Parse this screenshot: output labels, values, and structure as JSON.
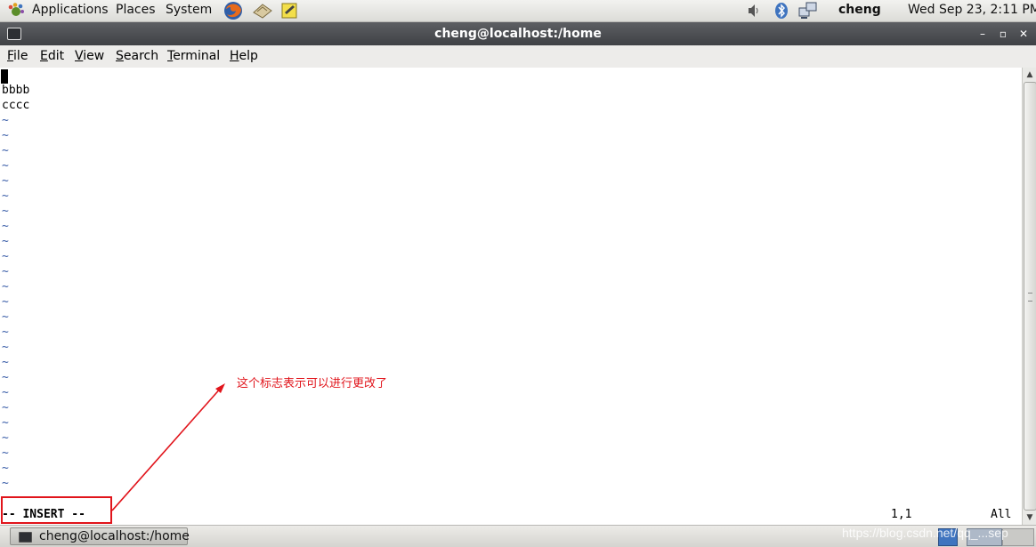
{
  "top_panel": {
    "menus": [
      "Applications",
      "Places",
      "System"
    ],
    "user": "cheng",
    "clock": "Wed Sep 23,  2:11 PM",
    "launcher_icons": [
      "firefox-icon",
      "mail-icon",
      "notes-icon"
    ],
    "tray_icons": [
      "volume-icon",
      "bluetooth-icon",
      "network-icon"
    ]
  },
  "window": {
    "title": "cheng@localhost:/home",
    "controls": [
      "–",
      "▫",
      "✕"
    ]
  },
  "menubar": {
    "items": [
      {
        "first": "F",
        "rest": "ile"
      },
      {
        "first": "E",
        "rest": "dit"
      },
      {
        "first": "V",
        "rest": "iew"
      },
      {
        "first": "S",
        "rest": "earch"
      },
      {
        "first": "T",
        "rest": "erminal"
      },
      {
        "first": "H",
        "rest": "elp"
      }
    ]
  },
  "editor": {
    "lines": [
      "",
      "bbbb",
      "cccc"
    ],
    "tilde": "~",
    "mode": "-- INSERT --",
    "position": "1,1",
    "scroll": "All"
  },
  "annotation": {
    "text": "这个标志表示可以进行更改了"
  },
  "taskbar": {
    "window_label": "cheng@localhost:/home"
  },
  "watermark": "https://blog.csdn.net/qq_...sep",
  "colors": {
    "annotation": "#e1141b",
    "tilde": "#3a5ea8",
    "titlebar": "#4a4c50"
  }
}
